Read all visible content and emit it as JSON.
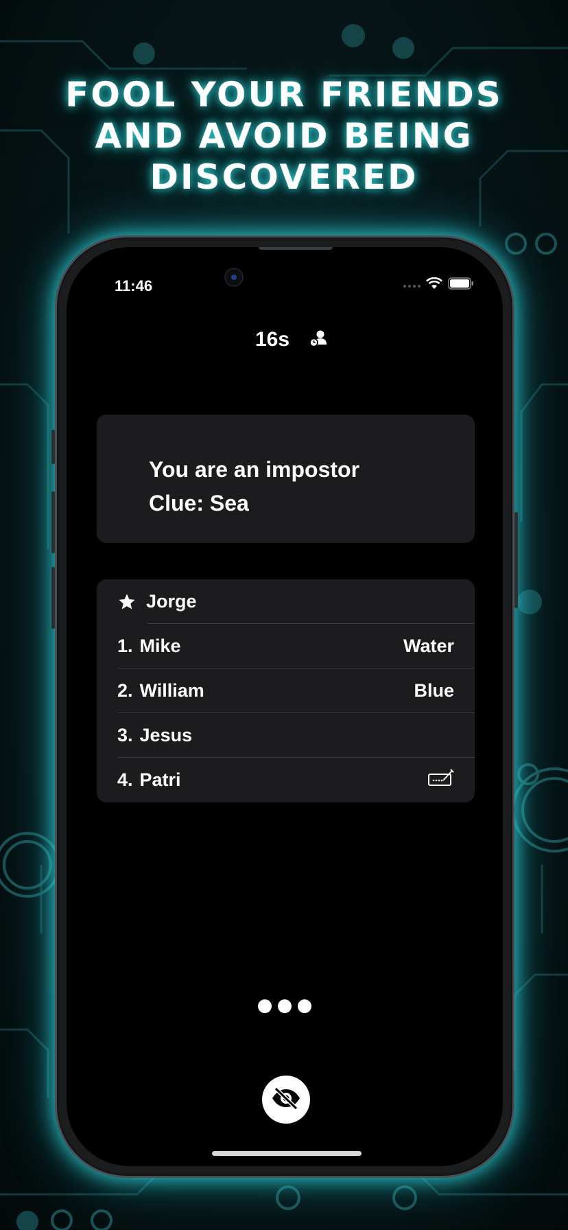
{
  "headline": {
    "line1": "FOOL YOUR FRIENDS",
    "line2": "AND AVOID BEING",
    "line3": "DISCOVERED"
  },
  "status_bar": {
    "time": "11:46",
    "icons": [
      "cellular-signal-icon",
      "wifi-icon",
      "battery-icon"
    ]
  },
  "timer": {
    "value": "16s",
    "icon": "player-timer-icon"
  },
  "role_card": {
    "line1": "You are an impostor",
    "line2": "Clue: Sea"
  },
  "players": {
    "host": {
      "name": "Jorge",
      "icon": "star-icon"
    },
    "list": [
      {
        "number": "1.",
        "name": "Mike",
        "word": "Water"
      },
      {
        "number": "2.",
        "name": "William",
        "word": "Blue"
      },
      {
        "number": "3.",
        "name": "Jesus",
        "word": ""
      },
      {
        "number": "4.",
        "name": "Patri",
        "word": "",
        "icon": "signature-icon"
      }
    ]
  },
  "controls": {
    "more_icon": "more-dots-icon",
    "hide_icon": "eye-slash-icon"
  },
  "colors": {
    "glow": "#32e6e6",
    "card_bg": "#1c1c1e",
    "screen_bg": "#000000"
  }
}
